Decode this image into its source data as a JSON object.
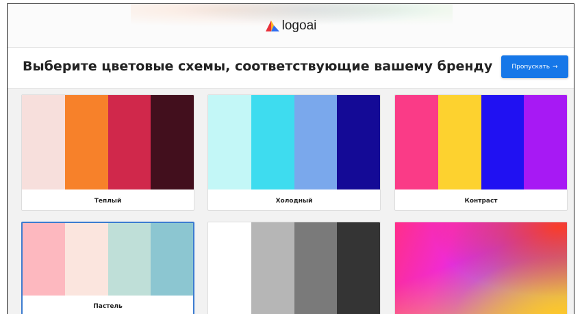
{
  "brand": {
    "name": "logoai",
    "logo_icon": "triangle-logo-icon"
  },
  "header": {
    "title": "Выберите цветовые схемы, соответствующие вашему бренду"
  },
  "actions": {
    "skip_label": "Пропускать",
    "skip_icon": "→"
  },
  "palettes": [
    {
      "label": "Теплый",
      "colors": [
        "#f7dfdc",
        "#f7812a",
        "#d0284b",
        "#420f1d"
      ]
    },
    {
      "label": "Холодный",
      "colors": [
        "#c3f7f7",
        "#3edcef",
        "#7aa8ec",
        "#140a96"
      ]
    },
    {
      "label": "Контраст",
      "colors": [
        "#fa3b87",
        "#fdd22f",
        "#2011f2",
        "#a719f4"
      ]
    },
    {
      "label": "Пастель",
      "colors": [
        "#fdb8bf",
        "#fbe5de",
        "#bfdfd8",
        "#8cc6d1"
      ],
      "selected": true
    },
    {
      "label": "",
      "colors": [
        "#ffffff",
        "#b6b6b6",
        "#7a7a7a",
        "#343434"
      ]
    },
    {
      "label": "",
      "type": "gradient"
    }
  ]
}
